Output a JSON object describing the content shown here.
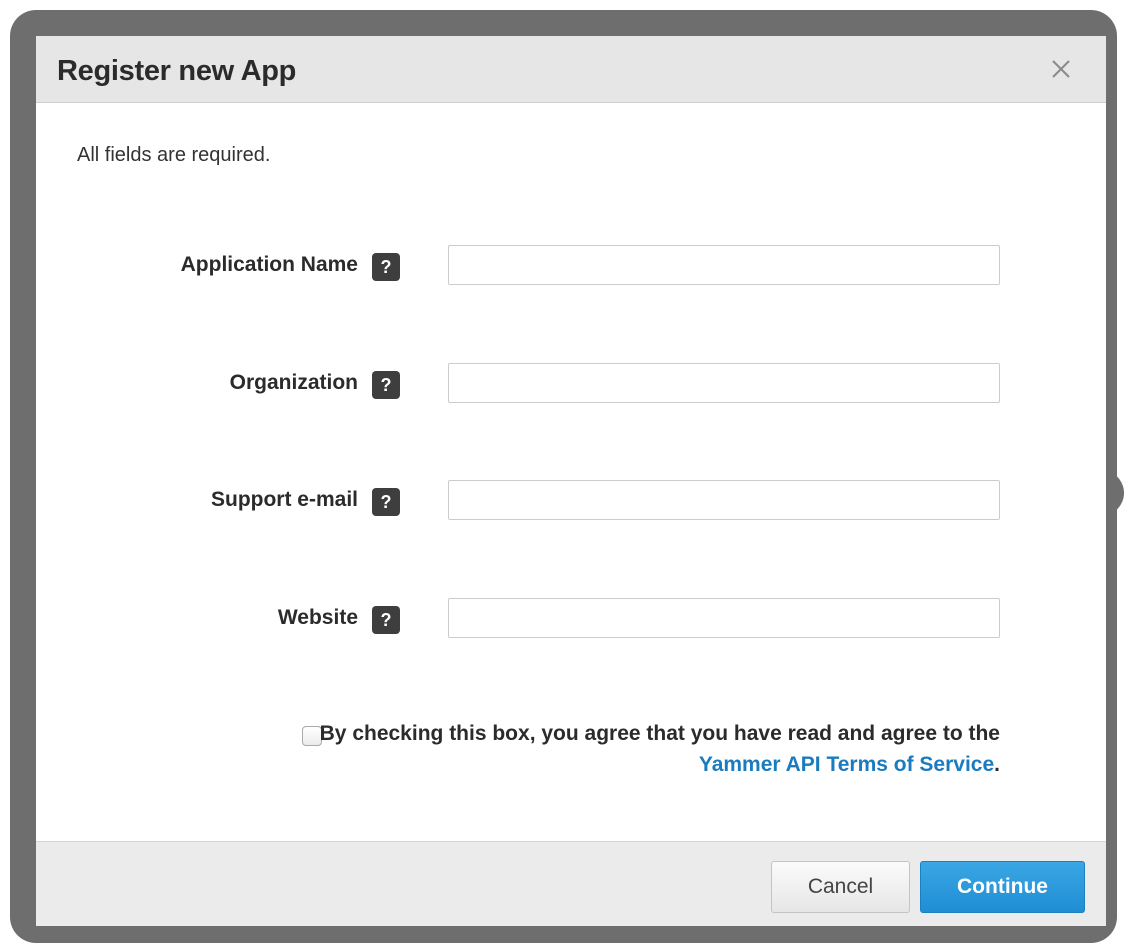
{
  "dialog": {
    "title": "Register new App",
    "close_glyph": "×",
    "close_icon": "close-icon",
    "intro": "All fields are required."
  },
  "fields": [
    {
      "label": "Application Name",
      "help": "?",
      "value": "",
      "placeholder": ""
    },
    {
      "label": "Organization",
      "help": "?",
      "value": "",
      "placeholder": ""
    },
    {
      "label": "Support e-mail",
      "help": "?",
      "value": "",
      "placeholder": ""
    },
    {
      "label": "Website",
      "help": "?",
      "value": "",
      "placeholder": ""
    }
  ],
  "agreement": {
    "checked": false,
    "text_before": "By checking this box, you agree that you have read and agree to the ",
    "link_text": "Yammer API Terms of Service",
    "text_after": "."
  },
  "footer": {
    "cancel_label": "Cancel",
    "continue_label": "Continue"
  },
  "colors": {
    "link": "#1b7bbf",
    "primary_button": "#1f8ed3",
    "header_bg": "#e6e6e6",
    "footer_bg": "#ebebeb",
    "help_icon_bg": "#3e3e3e"
  }
}
